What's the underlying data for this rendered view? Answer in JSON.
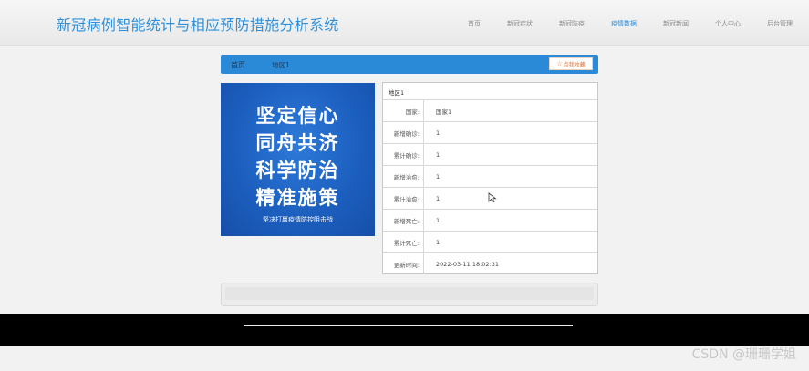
{
  "header": {
    "title": "新冠病例智能统计与相应预防措施分析系统",
    "nav": [
      "首页",
      "新冠症状",
      "新冠防疫",
      "疫情数据",
      "新冠新闻",
      "个人中心",
      "后台管理"
    ],
    "active_index": 3
  },
  "breadcrumb": {
    "home": "首页",
    "current": "地区1",
    "favorite": "点我收藏"
  },
  "poster": {
    "lines": [
      "坚定信心",
      "同舟共济",
      "科学防治",
      "精准施策"
    ],
    "sub": "坚决打赢疫情防控阻击战"
  },
  "info": {
    "title": "地区1",
    "rows": [
      {
        "label": "国家:",
        "value": "国家1"
      },
      {
        "label": "新增确诊:",
        "value": "1"
      },
      {
        "label": "累计确诊:",
        "value": "1"
      },
      {
        "label": "新增治愈:",
        "value": "1"
      },
      {
        "label": "累计治愈:",
        "value": "1"
      },
      {
        "label": "新增死亡:",
        "value": "1"
      },
      {
        "label": "累计死亡:",
        "value": "1"
      },
      {
        "label": "更新时间:",
        "value": "2022-03-11 18:02:31"
      }
    ]
  },
  "watermark": "CSDN @珊珊学姐",
  "colors": {
    "accent": "#2a8ad8",
    "favorite": "#e27232"
  }
}
